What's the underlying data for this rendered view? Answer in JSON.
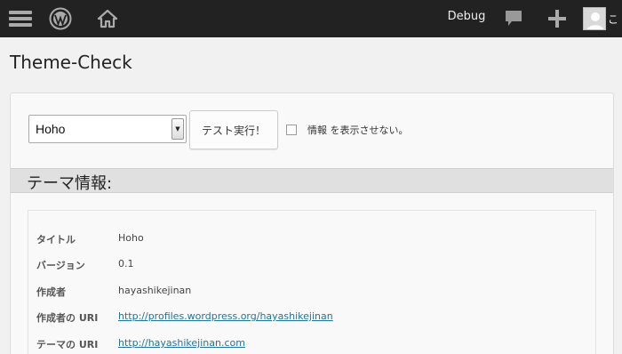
{
  "adminbar": {
    "debug_label": "Debug",
    "account_suffix": "こ",
    "icons": [
      "menu-icon",
      "wordpress-icon",
      "home-icon",
      "comment-icon",
      "plus-icon",
      "avatar"
    ]
  },
  "page": {
    "title": "Theme-Check"
  },
  "controls": {
    "theme_select_value": "Hoho",
    "run_button_label": "テスト実行！",
    "hide_checkbox_checked": false,
    "hide_label": "情報 を表示させない。"
  },
  "section": {
    "title": "テーマ情報:"
  },
  "info": [
    {
      "label": "タイトル",
      "value": "Hoho"
    },
    {
      "label": "バージョン",
      "value": "0.1"
    },
    {
      "label": "作成者",
      "value": "hayashikejinan"
    },
    {
      "label": "作成者の URI",
      "value": "http://profiles.wordpress.org/hayashikejinan"
    },
    {
      "label": "テーマの URI",
      "value": "http://hayashikejinan.com"
    }
  ],
  "colors": {
    "adminbar_bg": "#222222",
    "link": "#21759b",
    "section_bg": "#e0e0e0"
  }
}
